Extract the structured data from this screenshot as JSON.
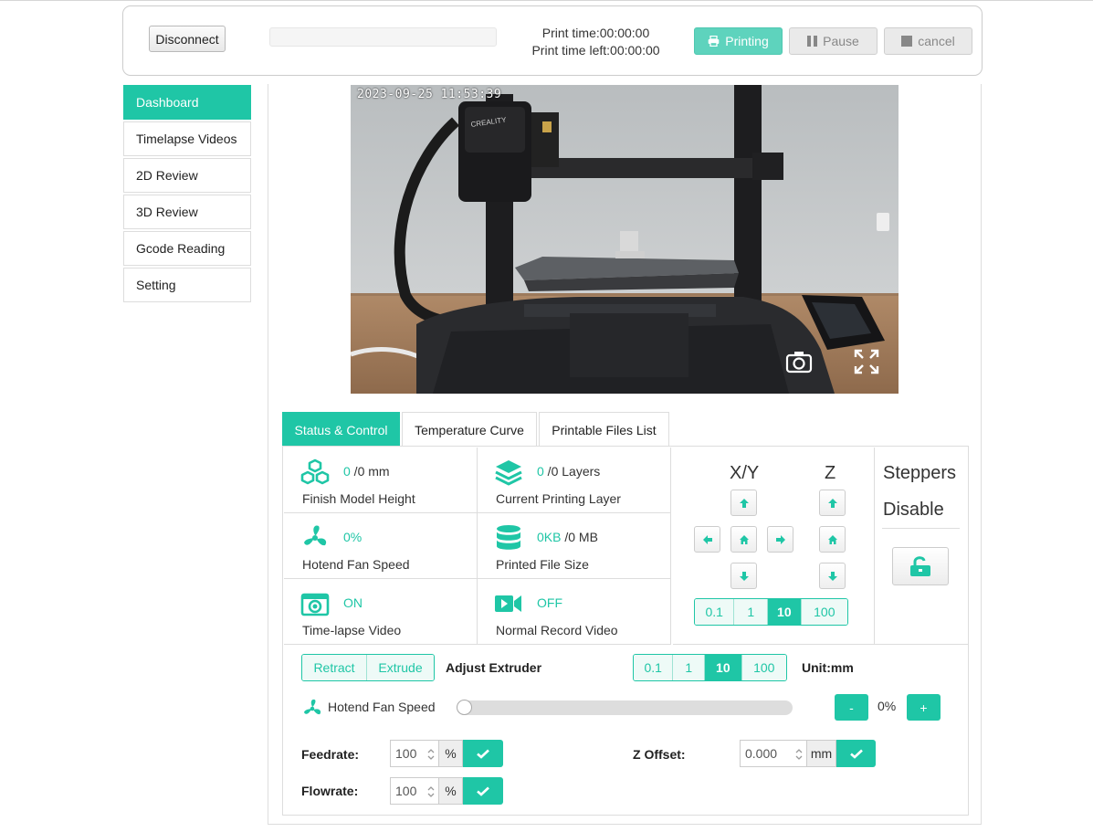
{
  "header": {
    "disconnect_label": "Disconnect",
    "progress_fraction": 0,
    "print_time": "Print time:00:00:00",
    "print_time_left": "Print time left:00:00:00",
    "printing_label": "Printing",
    "pause_label": "Pause",
    "cancel_label": "cancel"
  },
  "sidebar": {
    "items": [
      {
        "label": "Dashboard",
        "active": true
      },
      {
        "label": "Timelapse Videos"
      },
      {
        "label": "2D Review"
      },
      {
        "label": "3D Review"
      },
      {
        "label": "Gcode Reading"
      },
      {
        "label": "Setting"
      }
    ]
  },
  "camera": {
    "timestamp": "2023-09-25 11:53:39",
    "brand_on_hotend": "CREALITY"
  },
  "tabs": [
    {
      "label": "Status & Control",
      "active": true
    },
    {
      "label": "Temperature Curve"
    },
    {
      "label": "Printable Files List"
    }
  ],
  "stats": {
    "model_height": {
      "value": "0",
      "rest": " /0 mm",
      "label": "Finish Model Height",
      "icon": "cubes-icon"
    },
    "layer": {
      "value": "0",
      "rest": " /0 Layers",
      "label": "Current Printing Layer",
      "icon": "layers-icon"
    },
    "fan": {
      "value": "0%",
      "rest": "",
      "label": "Hotend Fan Speed",
      "icon": "fan-icon"
    },
    "file_size": {
      "value": "0KB",
      "rest": " /0 MB",
      "label": "Printed File Size",
      "icon": "database-icon"
    },
    "timelapse": {
      "value": "ON",
      "rest": "",
      "label": "Time-lapse Video",
      "icon": "camera-icon"
    },
    "record": {
      "value": "OFF",
      "rest": "",
      "label": "Normal Record Video",
      "icon": "video-icon"
    }
  },
  "motion": {
    "xy_label": "X/Y",
    "z_label": "Z",
    "steps": [
      "0.1",
      "1",
      "10",
      "100"
    ],
    "selected_step": "10"
  },
  "steppers": {
    "line1": "Steppers",
    "line2": "Disable"
  },
  "extruder": {
    "retract_label": "Retract",
    "extrude_label": "Extrude",
    "adjust_label": "Adjust Extruder",
    "steps": [
      "0.1",
      "1",
      "10",
      "100"
    ],
    "selected_step": "10",
    "unit_label": "Unit:mm"
  },
  "fan_control": {
    "label": "Hotend Fan Speed",
    "value": "0%",
    "level_percent": 0,
    "minus_label": "-",
    "plus_label": "+"
  },
  "feedrate": {
    "label": "Feedrate:",
    "value": "100",
    "unit": "%"
  },
  "flowrate": {
    "label": "Flowrate:",
    "value": "100",
    "unit": "%"
  },
  "zoffset": {
    "label": "Z Offset:",
    "value": "0.000",
    "unit": "mm"
  },
  "colors": {
    "accent": "#1fc6a6"
  }
}
